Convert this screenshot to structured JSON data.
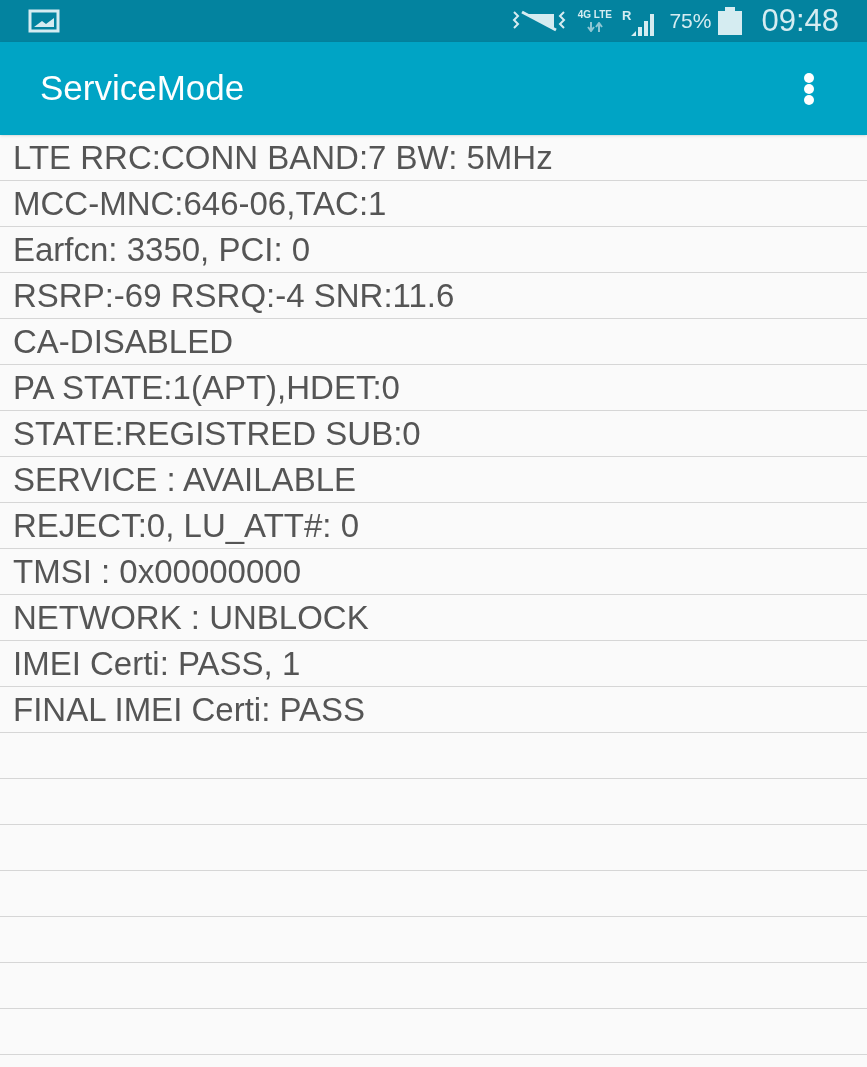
{
  "status_bar": {
    "network_type": "4G LTE",
    "roaming": "R",
    "battery": "75%",
    "time": "09:48"
  },
  "app_bar": {
    "title": "ServiceMode"
  },
  "lines": [
    "LTE RRC:CONN BAND:7 BW: 5MHz",
    "MCC-MNC:646-06,TAC:1",
    "Earfcn: 3350, PCI: 0",
    "RSRP:-69 RSRQ:-4 SNR:11.6",
    "CA-DISABLED",
    "PA STATE:1(APT),HDET:0",
    "STATE:REGISTRED SUB:0",
    "SERVICE : AVAILABLE",
    "REJECT:0, LU_ATT#: 0",
    "TMSI : 0x00000000",
    "NETWORK : UNBLOCK",
    "IMEI Certi: PASS, 1",
    "FINAL IMEI Certi: PASS"
  ]
}
